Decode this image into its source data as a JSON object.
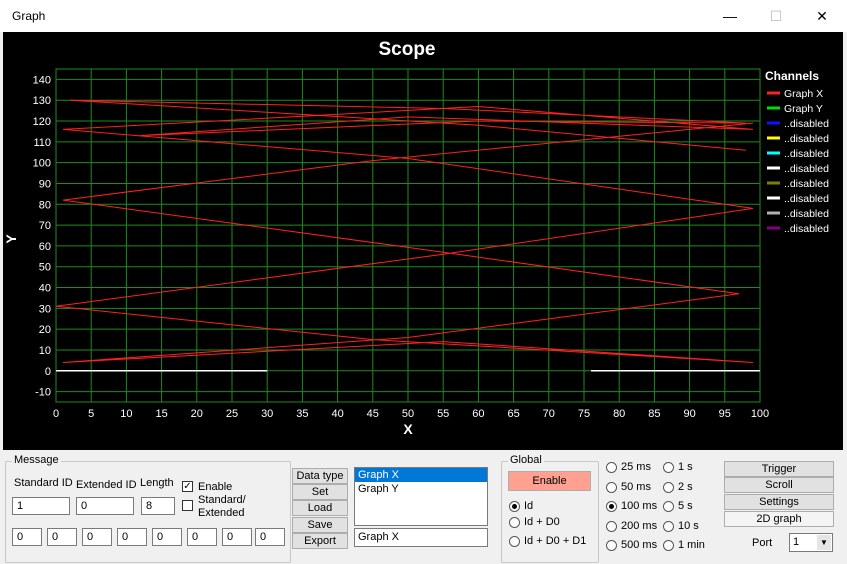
{
  "window": {
    "title": "Graph",
    "minimize": "—",
    "maximize": "☐",
    "close": "✕"
  },
  "chart_data": {
    "type": "line",
    "title": "Scope",
    "xlabel": "X",
    "ylabel": "Y",
    "xlim": [
      0,
      100
    ],
    "ylim": [
      -15,
      145
    ],
    "xticks": [
      0,
      5,
      10,
      15,
      20,
      25,
      30,
      35,
      40,
      45,
      50,
      55,
      60,
      65,
      70,
      75,
      80,
      85,
      90,
      95,
      100
    ],
    "yticks": [
      -10,
      0,
      10,
      20,
      30,
      40,
      50,
      60,
      70,
      80,
      90,
      100,
      110,
      120,
      130,
      140
    ],
    "grid": true,
    "legend": {
      "title": "Channels",
      "placement": "right"
    },
    "series": [
      {
        "name": "Graph X",
        "color": "#ff2020",
        "points": [
          [
            98,
            106
          ],
          [
            60,
            118
          ],
          [
            2,
            130
          ],
          [
            55,
            126
          ],
          [
            98,
            119
          ],
          [
            60,
            120
          ],
          [
            12,
            113
          ],
          [
            50,
            122
          ],
          [
            99,
            116
          ],
          [
            60,
            127
          ],
          [
            1,
            116
          ],
          [
            50,
            102
          ],
          [
            99,
            78
          ],
          [
            55,
            56
          ],
          [
            0,
            31
          ],
          [
            45,
            15
          ],
          [
            99,
            4
          ],
          [
            55,
            14
          ],
          [
            1,
            4
          ],
          [
            50,
            16
          ],
          [
            97,
            37
          ],
          [
            55,
            57
          ],
          [
            1,
            82
          ],
          [
            45,
            101
          ],
          [
            99,
            119
          ]
        ]
      },
      {
        "name": "Graph Y",
        "color": "#00e000",
        "points": []
      },
      {
        "name": "..disabled",
        "color": "#1010ff",
        "points": []
      },
      {
        "name": "..disabled",
        "color": "#ffff00",
        "points": []
      },
      {
        "name": "..disabled",
        "color": "#00ffff",
        "points": []
      },
      {
        "name": "..disabled",
        "color": "#ffffff",
        "points": [
          [
            0,
            0
          ],
          [
            30,
            0
          ],
          [
            76,
            0
          ],
          [
            100,
            0
          ]
        ]
      },
      {
        "name": "..disabled",
        "color": "#808000",
        "points": []
      },
      {
        "name": "..disabled",
        "color": "#ffffff",
        "points": []
      },
      {
        "name": "..disabled",
        "color": "#b0b0b0",
        "points": []
      },
      {
        "name": "..disabled",
        "color": "#800080",
        "points": []
      }
    ]
  },
  "message": {
    "group_label": "Message",
    "standard_id_label": "Standard ID",
    "extended_id_label": "Extended ID",
    "length_label": "Length",
    "standard_id": "1",
    "extended_id": "0",
    "length": "8",
    "enable_label": "Enable",
    "enable_checked": "✓",
    "std_ext_label_1": "Standard/",
    "std_ext_label_2": "Extended",
    "data_bytes": [
      "0",
      "0",
      "0",
      "0",
      "0",
      "0",
      "0",
      "0"
    ]
  },
  "buttons": {
    "data_type": "Data type",
    "set": "Set",
    "load": "Load",
    "save": "Save",
    "export": "Export"
  },
  "graph_list": {
    "items": [
      "Graph X",
      "Graph Y"
    ],
    "selected": "Graph X",
    "name_field": "Graph X"
  },
  "global": {
    "group_label": "Global",
    "enable_button": "Enable",
    "modes": [
      "Id",
      "Id + D0",
      "Id + D0 + D1"
    ]
  },
  "timebase": {
    "col1": [
      "25 ms",
      "50 ms",
      "100 ms",
      "200 ms",
      "500 ms"
    ],
    "col2": [
      "1 s",
      "2 s",
      "5 s",
      "10 s",
      "1 min"
    ]
  },
  "right_controls": {
    "trigger": "Trigger",
    "scroll": "Scroll",
    "settings": "Settings",
    "graph2d": "2D graph",
    "port_label": "Port",
    "port_value": "1"
  }
}
